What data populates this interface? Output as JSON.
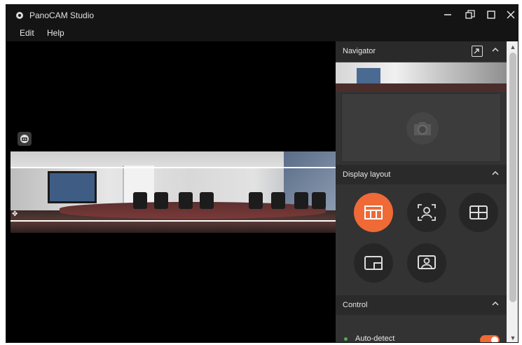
{
  "window": {
    "title": "PanoCAM Studio",
    "controls": [
      "minimize",
      "restore",
      "maximize",
      "close"
    ]
  },
  "menu": {
    "items": [
      {
        "label": "Edit"
      },
      {
        "label": "Help"
      }
    ]
  },
  "panel": {
    "navigator": {
      "title": "Navigator"
    },
    "display_layout": {
      "title": "Display layout",
      "options": [
        {
          "icon": "panorama-layout-icon",
          "active": true
        },
        {
          "icon": "speaker-focus-icon",
          "active": false
        },
        {
          "icon": "grid-layout-icon",
          "active": false
        },
        {
          "icon": "picture-in-picture-icon",
          "active": false
        },
        {
          "icon": "presenter-icon",
          "active": false
        }
      ]
    },
    "control": {
      "title": "Control",
      "auto_detect_label": "Auto-detect",
      "auto_detect_on": true
    }
  },
  "colors": {
    "accent": "#ef6a36",
    "panel": "#333333",
    "header": "#2a2a2a",
    "titlebar": "#141414"
  }
}
